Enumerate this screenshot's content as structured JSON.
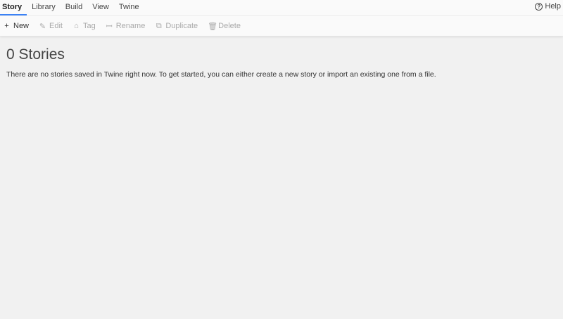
{
  "tabs": [
    {
      "label": "Story",
      "active": true
    },
    {
      "label": "Library"
    },
    {
      "label": "Build"
    },
    {
      "label": "View"
    },
    {
      "label": "Twine"
    }
  ],
  "help": {
    "label": "Help"
  },
  "toolbar": {
    "new": "New",
    "edit": "Edit",
    "tag": "Tag",
    "rename": "Rename",
    "duplicate": "Duplicate",
    "delete": "Delete"
  },
  "main": {
    "title": "0 Stories",
    "message": "There are no stories saved in Twine right now. To get started, you can either create a new story or import an existing one from a file."
  },
  "colors": {
    "accent": "#3b82f6",
    "background": "#f1f1f1"
  }
}
